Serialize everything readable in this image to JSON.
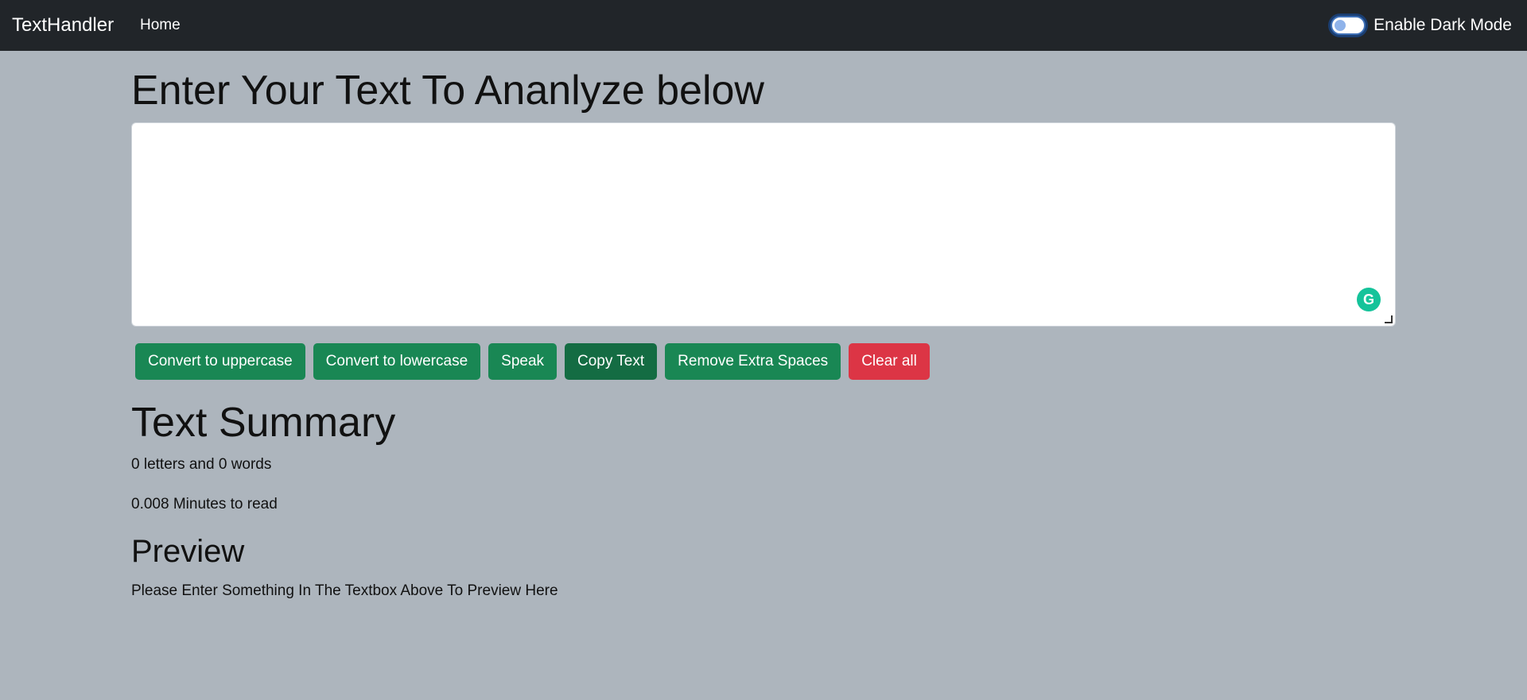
{
  "navbar": {
    "brand": "TextHandler",
    "home_link": "Home",
    "dark_mode_label": "Enable Dark Mode"
  },
  "main": {
    "heading": "Enter Your Text To Ananlyze below",
    "textarea_value": "",
    "grammarly_badge": "G",
    "buttons": [
      "Convert to uppercase",
      "Convert to lowercase",
      "Speak",
      "Copy Text",
      "Remove Extra Spaces",
      "Clear all"
    ]
  },
  "summary": {
    "title": "Text Summary",
    "counts": "0 letters and 0 words",
    "read_time": "0.008 Minutes to read"
  },
  "preview": {
    "title": "Preview",
    "text": "Please Enter Something In The Textbox Above To Preview Here"
  },
  "colors": {
    "navbar_bg": "#212529",
    "page_bg": "#adb5bd",
    "success": "#198754",
    "danger": "#dc3545",
    "grammarly": "#15c39a"
  }
}
